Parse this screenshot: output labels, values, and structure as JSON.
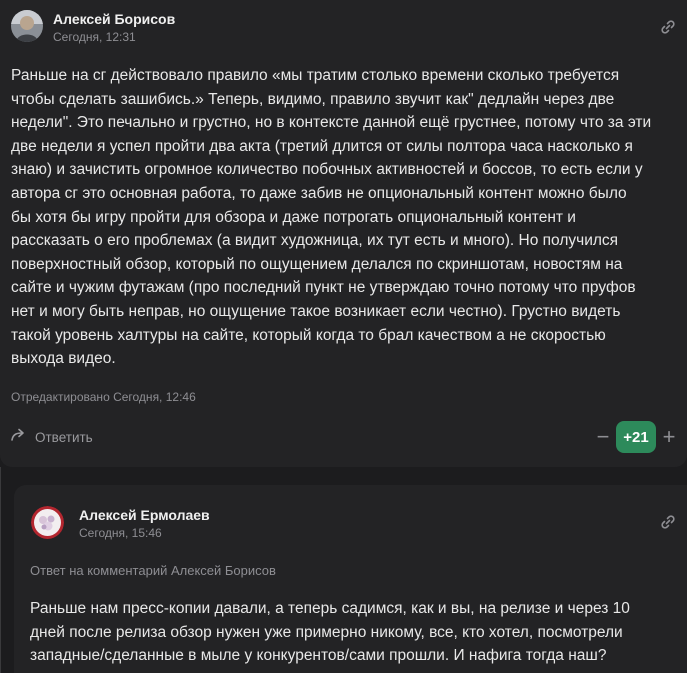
{
  "comments": [
    {
      "author": "Алексей Борисов",
      "time": "Сегодня, 12:31",
      "text": "Раньше на сг действовало правило «мы тратим столько времени сколько требуется\nчтобы сделать зашибись.» Теперь, видимо, правило звучит как\" дедлайн через две\nнедели\". Это печально и грустно, но в контексте данной ещё грустнее, потому что за эти\nдве недели я успел пройти два акта (третий длится от силы полтора часа насколько я\nзнаю) и зачистить огромное количество побочных активностей и боссов, то есть если у\nавтора сг это основная работа, то даже забив не опциональный контент можно было\nбы хотя бы игру пройти для обзора и даже потрогать опциональный контент и\nрассказать о его проблемах (а видит художница, их тут есть и много). Но получился\nповерхностный обзор, который по ощущением делался по скриншотам, новостям на\nсайте и чужим футажам (про последний пункт не утверждаю точно потому что пруфов\nнет и могу быть неправ, но ощущение такое возникает если честно). Грустно видеть\nтакой уровень халтуры на сайте, который когда то брал качеством а не скоростью\nвыхода видео.",
      "edited": "Отредактировано Сегодня, 12:46",
      "reply_label": "Ответить",
      "score": "+21",
      "minus": "−",
      "plus": "+"
    },
    {
      "author": "Алексей Ермолаев",
      "time": "Сегодня, 15:46",
      "reply_to": "Ответ на комментарий Алексей Борисов",
      "text": "Раньше нам пресс-копии давали, а теперь садимся, как и вы, на релизе и через 10\nдней после релиза обзор нужен уже примерно никому, все, кто хотел, посмотрели\nзападные/сделанные в мыле у конкурентов/сами прошли. И нафига тогда наш?"
    }
  ],
  "icons": {
    "link": "link-icon",
    "reply": "reply-arrow-icon"
  },
  "colors": {
    "background": "#1c1c1e",
    "card": "#232325",
    "score_bg": "#2d8a5b",
    "muted": "#8e8e93"
  }
}
